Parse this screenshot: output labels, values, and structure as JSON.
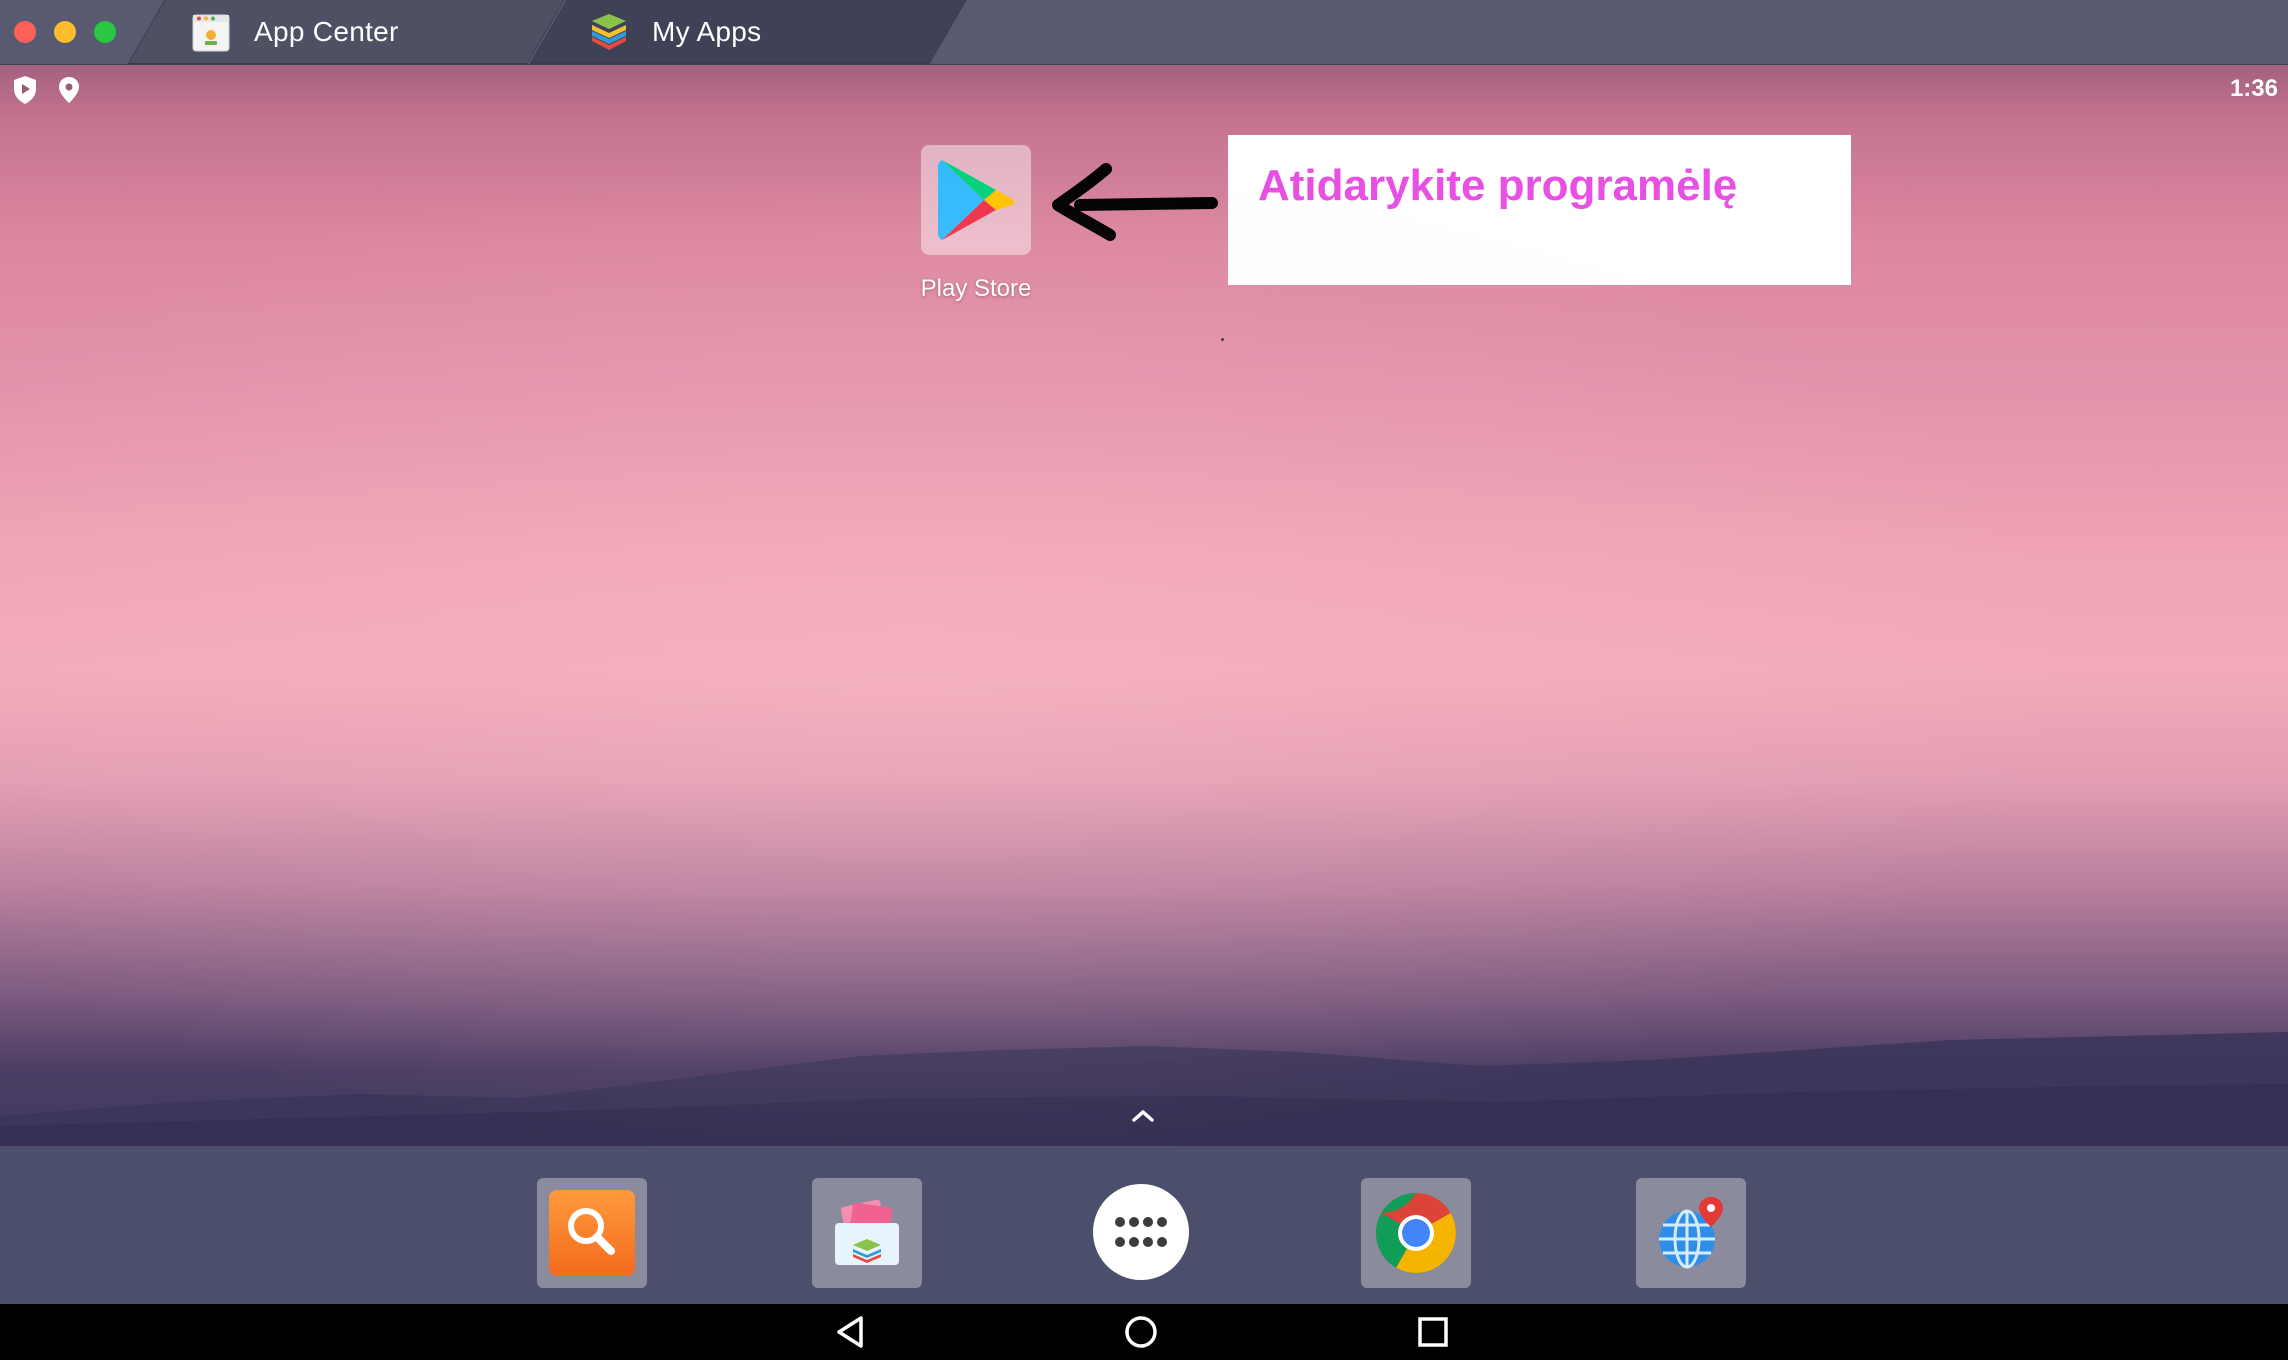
{
  "window": {
    "tabs": [
      {
        "label": "App Center",
        "icon": "app-center-icon"
      },
      {
        "label": "My Apps",
        "icon": "bluestacks-layers-icon"
      }
    ]
  },
  "statusbar": {
    "left_icons": [
      "shield-icon",
      "location-pin-icon"
    ],
    "time": "1:36"
  },
  "desktop": {
    "apps": [
      {
        "label": "Play Store",
        "icon": "play-store-icon"
      }
    ],
    "annotation": {
      "text": "Atidarykite programėlę",
      "color": "#e84fe3"
    }
  },
  "dock": {
    "items": [
      {
        "icon": "search-app-icon"
      },
      {
        "icon": "media-manager-icon"
      },
      {
        "icon": "app-drawer-icon"
      },
      {
        "icon": "chrome-icon"
      },
      {
        "icon": "web-globe-icon"
      }
    ]
  },
  "navbar": {
    "buttons": [
      "back-icon",
      "home-icon",
      "recents-icon"
    ]
  },
  "colors": {
    "titlebar": "#585b70",
    "dock": "#4c4f6b",
    "annotation": "#e84fe3"
  }
}
